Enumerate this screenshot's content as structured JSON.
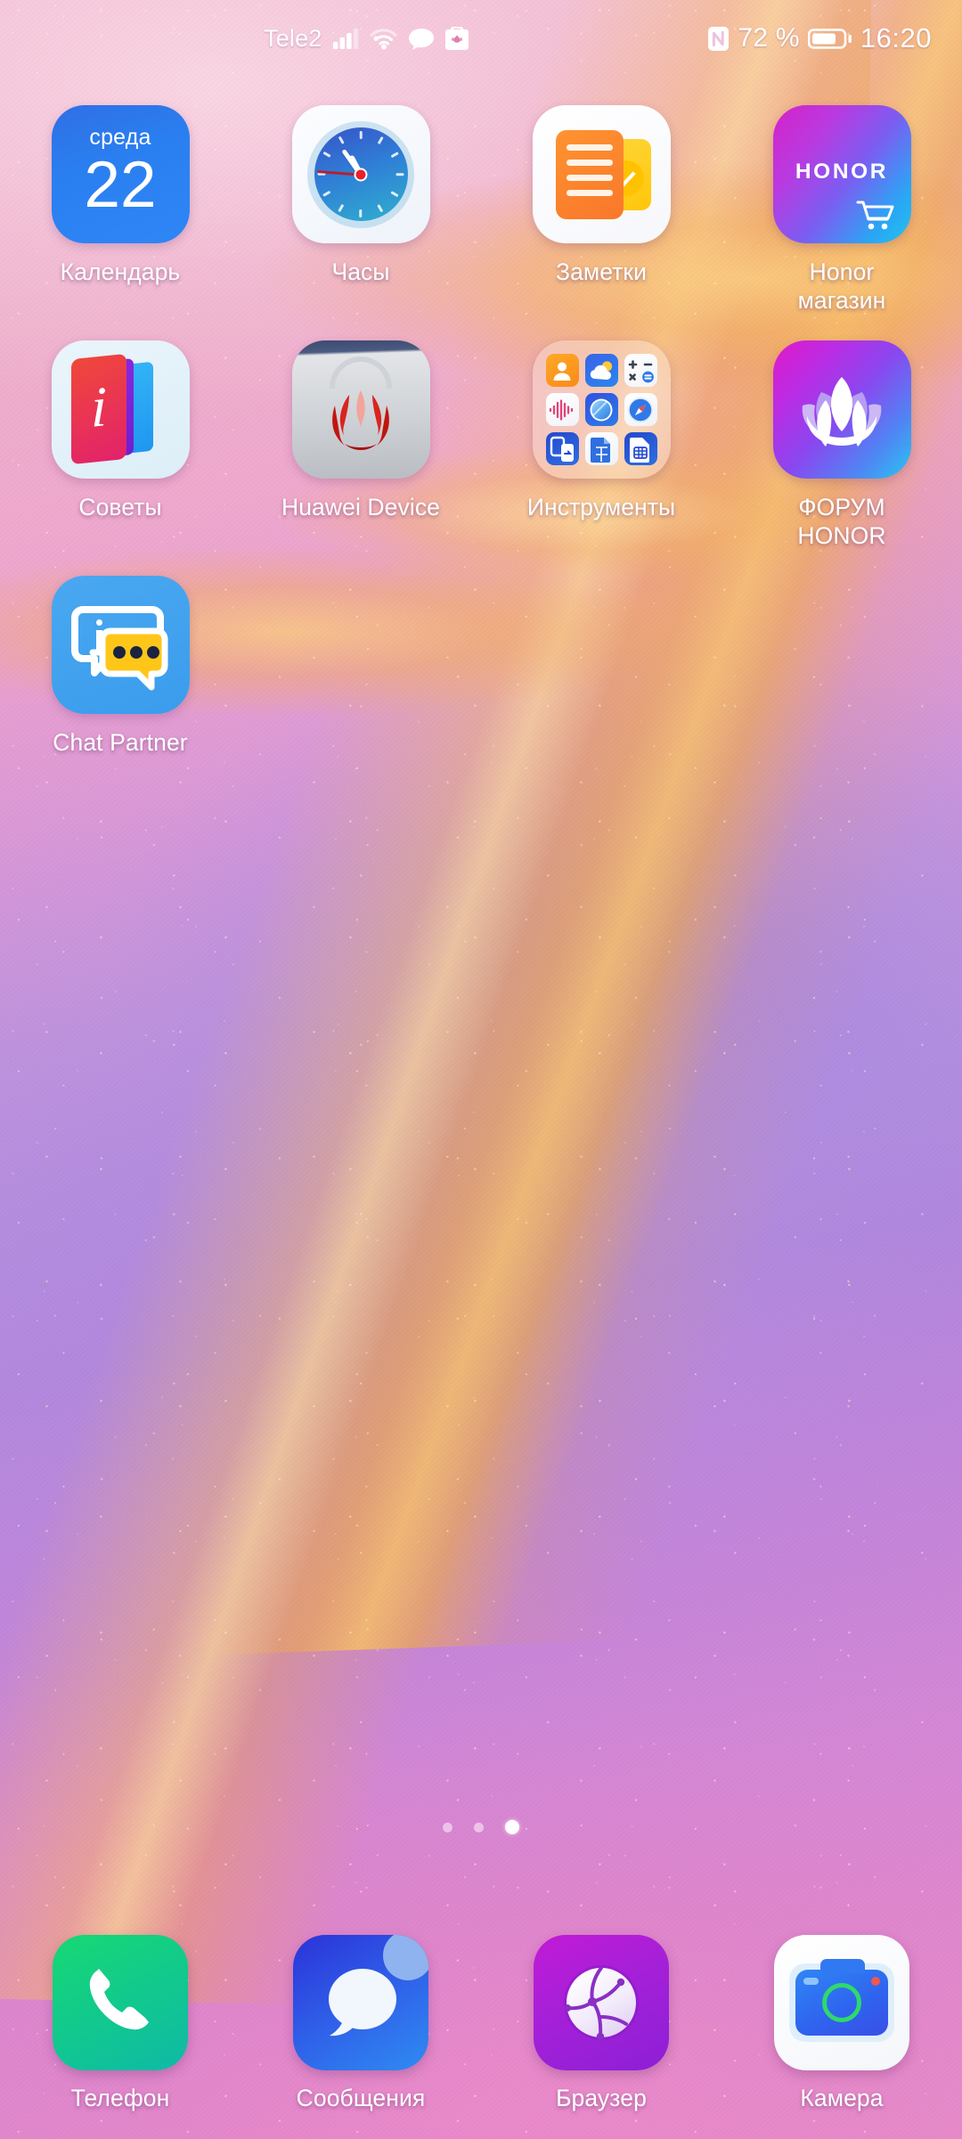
{
  "status_bar": {
    "carrier": "Tele2",
    "icons": [
      "signal-bars-icon",
      "wifi-icon",
      "chat-bubble-icon",
      "appgallery-icon",
      "nfc-icon"
    ],
    "battery_percent": "72 %",
    "battery_icon": "battery-icon",
    "time": "16:20"
  },
  "home": {
    "rows": [
      [
        {
          "id": "calendar",
          "label": "Календарь",
          "icon": "calendar-icon",
          "day_of_week": "среда",
          "day_number": "22",
          "color": "#2a7ff0"
        },
        {
          "id": "clock",
          "label": "Часы",
          "icon": "clock-icon",
          "color": "#2f7ed6"
        },
        {
          "id": "notes",
          "label": "Заметки",
          "icon": "notes-icon",
          "color": "#ff9331"
        },
        {
          "id": "honor-store",
          "label": "Honor\nмагазин",
          "icon": "honor-store-icon",
          "brand_text": "HONOR",
          "color": "#b93ae0"
        }
      ],
      [
        {
          "id": "tips",
          "label": "Советы",
          "icon": "tips-icon",
          "glyph": "i",
          "color": "#e2226b"
        },
        {
          "id": "huawei-device",
          "label": "Huawei Device",
          "icon": "huawei-device-icon",
          "color": "#cfd2d6"
        },
        {
          "id": "tools-folder",
          "label": "Инструменты",
          "icon": "folder-icon",
          "folder_items": [
            "contacts-icon",
            "weather-icon",
            "calculator-icon",
            "voice-recorder-icon",
            "mirror-icon",
            "compass-icon",
            "phone-clone-icon",
            "files-icon",
            "sim-toolkit-icon"
          ]
        },
        {
          "id": "forum-honor",
          "label": "ФОРУМ\nHONOR",
          "icon": "lotus-icon",
          "color": "#8b46ef"
        }
      ],
      [
        {
          "id": "chat-partner",
          "label": "Chat Partner",
          "icon": "chat-partner-icon",
          "glyph": "i",
          "color": "#4aa8f0"
        }
      ]
    ]
  },
  "page_indicator": {
    "count": 3,
    "active_index": 2
  },
  "dock": {
    "items": [
      {
        "id": "phone",
        "label": "Телефон",
        "icon": "phone-handset-icon",
        "color": "#12c98d"
      },
      {
        "id": "messages",
        "label": "Сообщения",
        "icon": "message-bubble-icon",
        "color": "#2f5ee8",
        "badge": true
      },
      {
        "id": "browser",
        "label": "Браузер",
        "icon": "globe-icon",
        "color": "#a520d8"
      },
      {
        "id": "camera",
        "label": "Камера",
        "icon": "camera-icon",
        "color": "#2f86f5"
      }
    ]
  }
}
